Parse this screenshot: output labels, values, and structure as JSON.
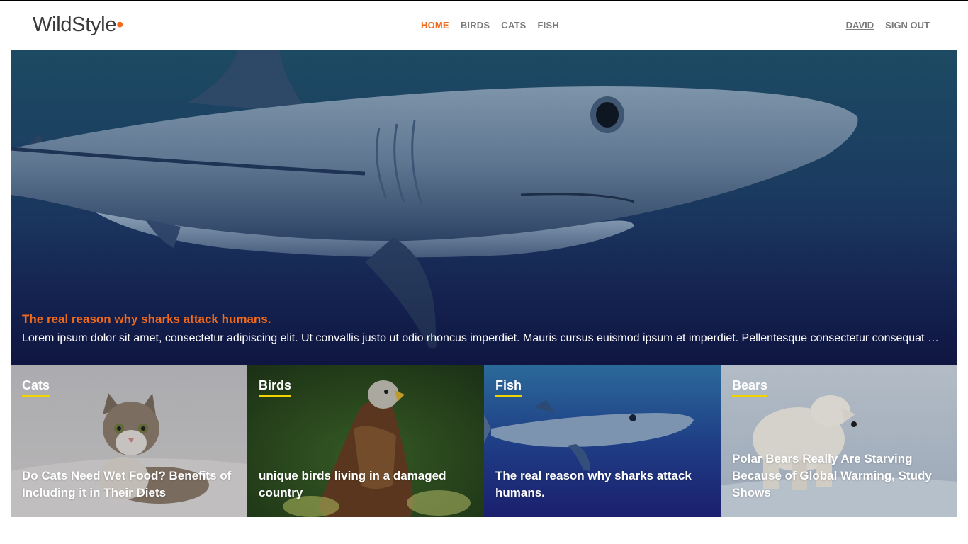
{
  "brand": {
    "name": "WildStyle",
    "dot": "•",
    "accent": "#f26a1b"
  },
  "nav": {
    "items": [
      {
        "label": "HOME",
        "active": true
      },
      {
        "label": "BIRDS",
        "active": false
      },
      {
        "label": "CATS",
        "active": false
      },
      {
        "label": "FISH",
        "active": false
      }
    ]
  },
  "user": {
    "name": "DAVID",
    "signout": "SIGN OUT"
  },
  "hero": {
    "title": "The real reason why sharks attack humans.",
    "excerpt": "Lorem ipsum dolor sit amet, consectetur adipiscing elit. Ut convallis justo ut odio rhoncus imperdiet. Mauris cursus euismod ipsum et imperdiet. Pellentesque consectetur consequat massa."
  },
  "cards": [
    {
      "category": "Cats",
      "title": "Do Cats Need Wet Food? Benefits of Including it in Their Diets"
    },
    {
      "category": "Birds",
      "title": "unique birds living in a damaged country"
    },
    {
      "category": "Fish",
      "title": "The real reason why sharks attack humans."
    },
    {
      "category": "Bears",
      "title": "Polar Bears Really Are Starving Because of Global Warming, Study Shows"
    }
  ],
  "colors": {
    "underline": "#f0d300",
    "nav_inactive": "#7a7a7a"
  }
}
